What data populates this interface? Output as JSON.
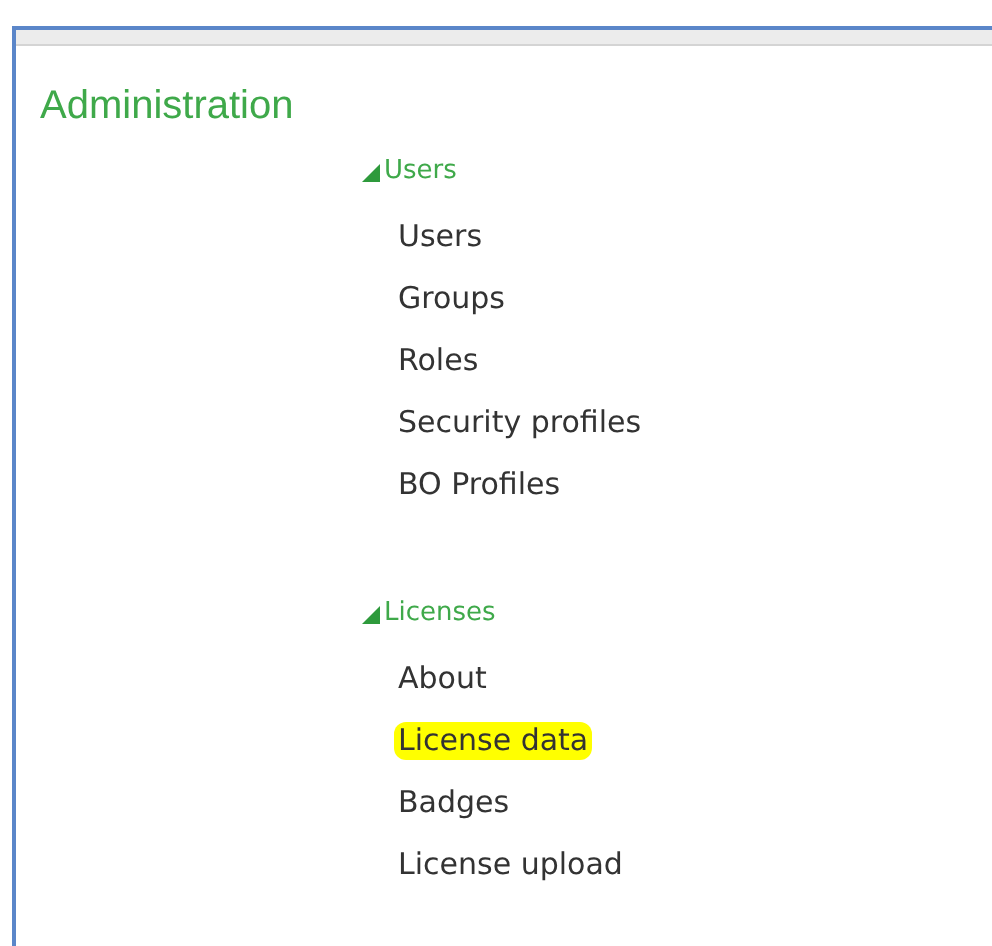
{
  "title": "Administration",
  "sections": [
    {
      "label": "Users",
      "expanded": true,
      "items": [
        {
          "label": "Users",
          "highlighted": false
        },
        {
          "label": "Groups",
          "highlighted": false
        },
        {
          "label": "Roles",
          "highlighted": false
        },
        {
          "label": "Security profiles",
          "highlighted": false
        },
        {
          "label": "BO Profiles",
          "highlighted": false
        }
      ]
    },
    {
      "label": "Licenses",
      "expanded": true,
      "items": [
        {
          "label": "About",
          "highlighted": false
        },
        {
          "label": "License data",
          "highlighted": true
        },
        {
          "label": "Badges",
          "highlighted": false
        },
        {
          "label": "License upload",
          "highlighted": false
        }
      ]
    }
  ]
}
